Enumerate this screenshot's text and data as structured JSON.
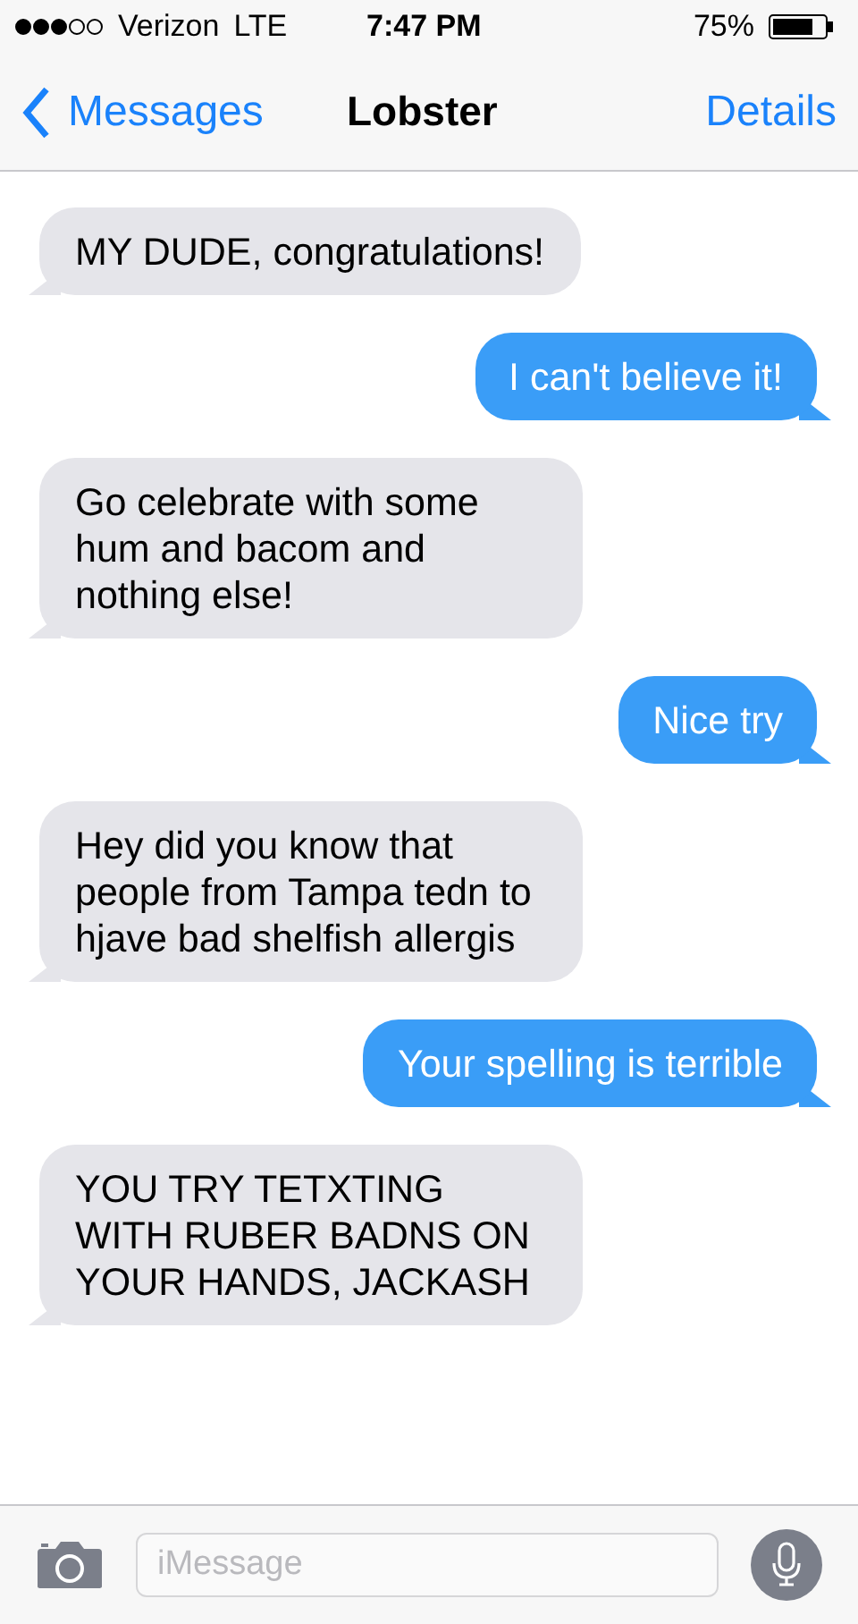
{
  "status_bar": {
    "carrier": "Verizon",
    "network": "LTE",
    "time": "7:47 PM",
    "battery_percent": "75%"
  },
  "nav": {
    "back": "Messages",
    "title": "Lobster",
    "action": "Details"
  },
  "messages": [
    {
      "kind": "received",
      "text": "MY DUDE, congratulations!"
    },
    {
      "kind": "sent",
      "text": "I can't believe it!"
    },
    {
      "kind": "received",
      "text": "Go celebrate with some hum and bacom and nothing else!"
    },
    {
      "kind": "sent",
      "text": "Nice try"
    },
    {
      "kind": "received",
      "text": "Hey did you know that people from Tampa tedn to hjave bad shelfish allergis"
    },
    {
      "kind": "sent",
      "text": "Your spelling is terrible"
    },
    {
      "kind": "received",
      "text": "YOU TRY TETXTING WITH RUBER BADNS ON YOUR HANDS, JACKASH"
    }
  ],
  "input": {
    "placeholder": "iMessage"
  }
}
